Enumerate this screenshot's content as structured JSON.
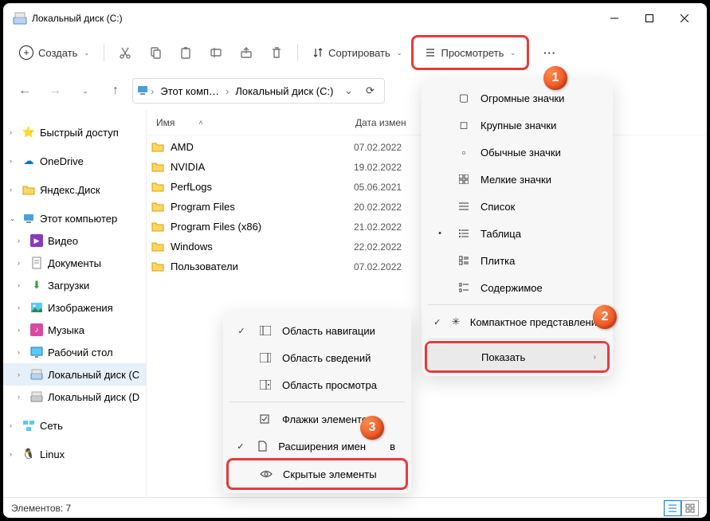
{
  "title": "Локальный диск (C:)",
  "toolbar": {
    "create": "Создать",
    "sort": "Сортировать",
    "view": "Просмотреть"
  },
  "breadcrumbs": [
    "Этот комп…",
    "Локальный диск (C:)"
  ],
  "sidebar": {
    "quick": "Быстрый доступ",
    "onedrive": "OneDrive",
    "yandex": "Яндекс.Диск",
    "pc": "Этот компьютер",
    "video": "Видео",
    "docs": "Документы",
    "downloads": "Загрузки",
    "images": "Изображения",
    "music": "Музыка",
    "desktop": "Рабочий стол",
    "cdrive": "Локальный диск (C",
    "ddrive": "Локальный диск (D",
    "network": "Сеть",
    "linux": "Linux"
  },
  "columns": {
    "name": "Имя",
    "date": "Дата измен"
  },
  "files": [
    {
      "name": "AMD",
      "date": "07.02.2022"
    },
    {
      "name": "NVIDIA",
      "date": "19.02.2022"
    },
    {
      "name": "PerfLogs",
      "date": "05.06.2021"
    },
    {
      "name": "Program Files",
      "date": "20.02.2022"
    },
    {
      "name": "Program Files (x86)",
      "date": "21.02.2022"
    },
    {
      "name": "Windows",
      "date": "22.02.2022"
    },
    {
      "name": "Пользователи",
      "date": "07.02.2022"
    }
  ],
  "view_menu": {
    "huge": "Огромные значки",
    "large": "Крупные значки",
    "medium": "Обычные значки",
    "small": "Мелкие значки",
    "list": "Список",
    "details": "Таблица",
    "tiles": "Плитка",
    "content": "Содержимое",
    "compact": "Компактное представлени",
    "show": "Показать"
  },
  "show_menu": {
    "navpane": "Область навигации",
    "detailspane": "Область сведений",
    "previewpane": "Область просмотра",
    "checkboxes": "Флажки элементов",
    "extensions": "Расширения имен",
    "hidden": "Скрытые элементы",
    "ext_suffix": "в"
  },
  "footer": {
    "count": "Элементов: 7"
  }
}
